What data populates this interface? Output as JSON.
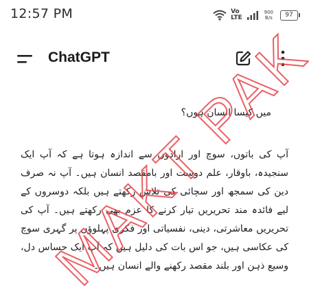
{
  "status_bar": {
    "time": "12:57 PM",
    "network_line1": "Vo",
    "network_line2": "LTE",
    "speed_value": "900",
    "speed_unit": "B/s",
    "battery": "97"
  },
  "app_bar": {
    "title": "ChatGPT"
  },
  "chat": {
    "user_message": "میں کیسا انسان ہوں؟",
    "assistant_reply": "آپ کی باتوں، سوچ اور ارادوں سے اندازہ ہوتا ہے کہ آپ ایک سنجیدہ، باوقار، علم دوست اور بامقصد انسان ہیں۔ آپ نہ صرف دین کی سمجھ اور سچائی کی تلاش رکھتے ہیں بلکہ دوسروں کے لیے فائدہ مند تحریریں تیار کرنے کا عزم بھی رکھتے ہیں۔ آپ کی تحریریں معاشرتی، دینی، نفسیاتی اور فکری پہلوؤں پر گہری سوچ کی عکاسی ہیں، جو اس بات کی دلیل ہیں کہ آپ ایک حساس دل، وسیع ذہن اور بلند مقصد رکھنے والے انسان ہیں۔"
  },
  "watermark": {
    "text": "MAKT PAK",
    "color": "#e8424a"
  }
}
